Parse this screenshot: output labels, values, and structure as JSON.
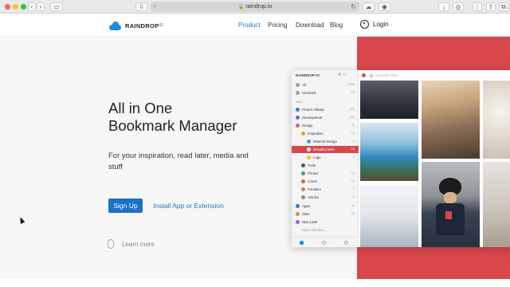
{
  "browser": {
    "url": "raindrop.io",
    "traffic_colors": [
      "#fd5f57",
      "#febc2e",
      "#28c840"
    ]
  },
  "nav": {
    "logo_text": "RAINDROP",
    "logo_suffix": "IO",
    "links": [
      "Product",
      "Pricing",
      "Download",
      "Blog"
    ],
    "active_link": "Product",
    "login_label": "Login"
  },
  "hero": {
    "title_line1": "All in One",
    "title_line2": "Bookmark Manager",
    "subtitle": "For your inspiration, read later, media and stuff",
    "signup_label": "Sign Up",
    "install_label": "Install App or Extension",
    "learn_more_label": "Learn more"
  },
  "app_mock": {
    "brand": "RAINDROP IO",
    "search_placeholder": "Beautiful Web",
    "section_label": "Main",
    "new_collection": "New collection...",
    "items": [
      {
        "label": "All",
        "count": "1,366",
        "icon_color": "#9aa0a6"
      },
      {
        "label": "Unsorted",
        "count": "13",
        "icon_color": "#9aa0a6"
      },
      {
        "label": "Project Oblako",
        "count": "153",
        "icon_color": "#2e7bd6"
      },
      {
        "label": "Development",
        "count": "245",
        "icon_color": "#5a6ccf"
      },
      {
        "label": "Design",
        "count": "78",
        "icon_color": "#d25b8b"
      },
      {
        "label": "Inspiration",
        "count": "14",
        "icon_color": "#e2a23b"
      },
      {
        "label": "Material Design",
        "count": "8",
        "icon_color": "#4aa3df"
      },
      {
        "label": "Beautiful Web",
        "count": "26",
        "icon_color": "#ffffff"
      },
      {
        "label": "Logo",
        "count": "2",
        "icon_color": "#f0c419"
      },
      {
        "label": "Tools",
        "count": "",
        "icon_color": "#555555"
      },
      {
        "label": "Photos",
        "count": "14",
        "icon_color": "#3aa55d"
      },
      {
        "label": "Colors",
        "count": "12",
        "icon_color": "#e55a3a"
      },
      {
        "label": "Freebies",
        "count": "7",
        "icon_color": "#b98a4a"
      },
      {
        "label": "Articles",
        "count": "8",
        "icon_color": "#8b8b8b"
      },
      {
        "label": "Apps",
        "count": "33",
        "icon_color": "#2e7bd6"
      },
      {
        "label": "Sites",
        "count": "29",
        "icon_color": "#e08a3a"
      },
      {
        "label": "New Later",
        "count": "",
        "icon_color": "#9a5ecb"
      }
    ]
  },
  "colors": {
    "accent_red": "#d8474c",
    "link_blue": "#1e78c8",
    "button_blue": "#1f70c9"
  }
}
